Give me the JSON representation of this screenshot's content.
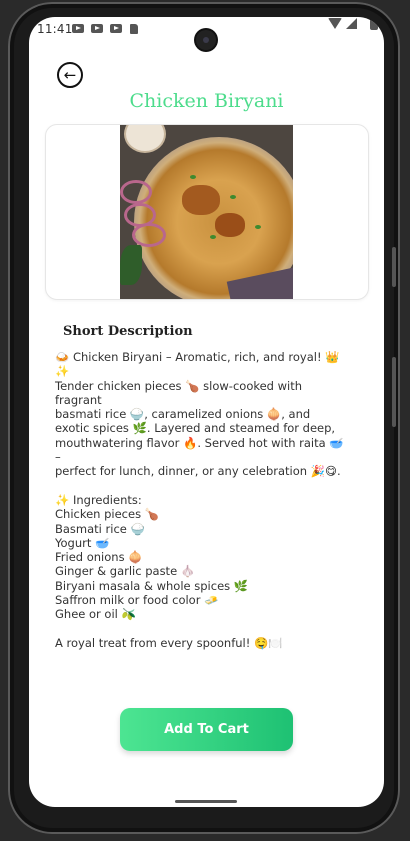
{
  "status_bar": {
    "time": "11:41",
    "notification_icons": [
      "youtube-icon",
      "youtube-icon",
      "youtube-icon",
      "sd-card-icon"
    ],
    "system_icons": [
      "wifi-icon",
      "signal-icon",
      "battery-icon"
    ]
  },
  "header": {
    "back_icon": "←",
    "title": "Chicken Biryani",
    "title_color": "#4ddc8c"
  },
  "product_image": {
    "icon": "food-image"
  },
  "description": {
    "heading": "Short Description",
    "intro_lines": [
      "🍛 Chicken Biryani – Aromatic, rich, and royal! 👑✨",
      "Tender chicken pieces 🍗 slow-cooked with fragrant",
      "basmati rice 🍚, caramelized onions 🧅, and",
      "exotic spices 🌿. Layered and steamed for deep,",
      "mouthwatering flavor 🔥. Served hot with raita 🥣 –",
      "perfect for lunch, dinner, or any celebration 🎉😋."
    ],
    "ingredients_heading": "✨ Ingredients:",
    "ingredients": [
      "Chicken pieces 🍗",
      "Basmati rice 🍚",
      "Yogurt 🥣",
      "Fried onions 🧅",
      "Ginger & garlic paste 🧄",
      "Biryani masala & whole spices 🌿",
      "Saffron milk or food color 🧈",
      "Ghee or oil 🫒"
    ],
    "closing": "A royal treat from every spoonful! 🤤🍽️"
  },
  "cart_button": {
    "label": "Add To Cart",
    "gradient_start": "#4de592",
    "gradient_end": "#1ec173"
  }
}
